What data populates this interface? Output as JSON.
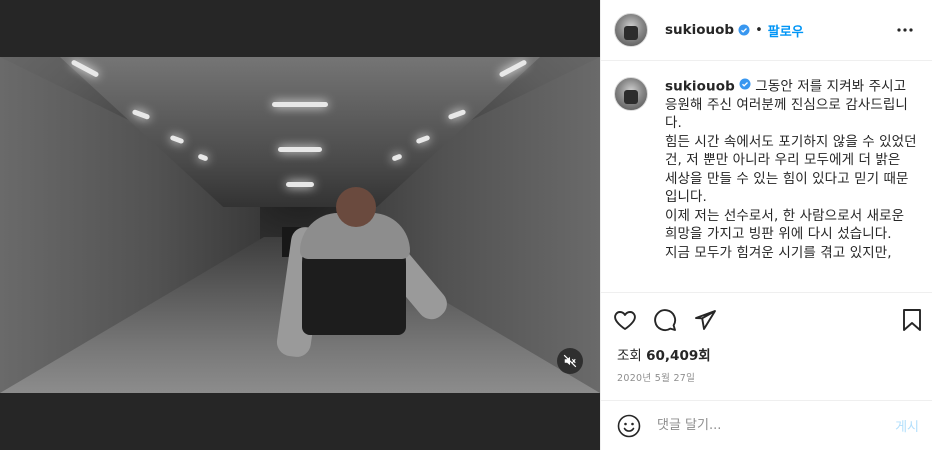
{
  "post": {
    "username": "sukiouob",
    "dot": "•",
    "follow_label": "팔로우",
    "caption_lines": [
      "그동안 저를 지켜봐 주시고 응원해 주신 여러분께 진심으로 감사드립니다.",
      "힘든 시간 속에서도 포기하지 않을 수 있었던 건, 저 뿐만 아니라 우리 모두에게 더 밝은 세상을 만들 수 있는 힘이 있다고 믿기 때문입니다.",
      "이제 저는 선수로서, 한 사람으로서 새로운 희망을 가지고 빙판 위에 다시 섰습니다.",
      "지금 모두가 힘겨운 시기를 겪고 있지만,"
    ],
    "views_label": "조회",
    "views_count": "60,409회",
    "date": "2020년 5월 27일"
  },
  "comment": {
    "placeholder": "댓글 달기...",
    "post_label": "게시"
  },
  "icons": {
    "verified": "verified-badge-icon",
    "more": "more-options-icon",
    "like": "heart-icon",
    "comment": "comment-icon",
    "share": "share-icon",
    "save": "bookmark-icon",
    "mute": "muted-speaker-icon",
    "emoji": "emoji-icon"
  },
  "colors": {
    "accent": "#0095f6",
    "verified": "#3897f0",
    "text": "#262626",
    "secondary": "#8e8e8e",
    "post_disabled": "#b2dffc"
  }
}
